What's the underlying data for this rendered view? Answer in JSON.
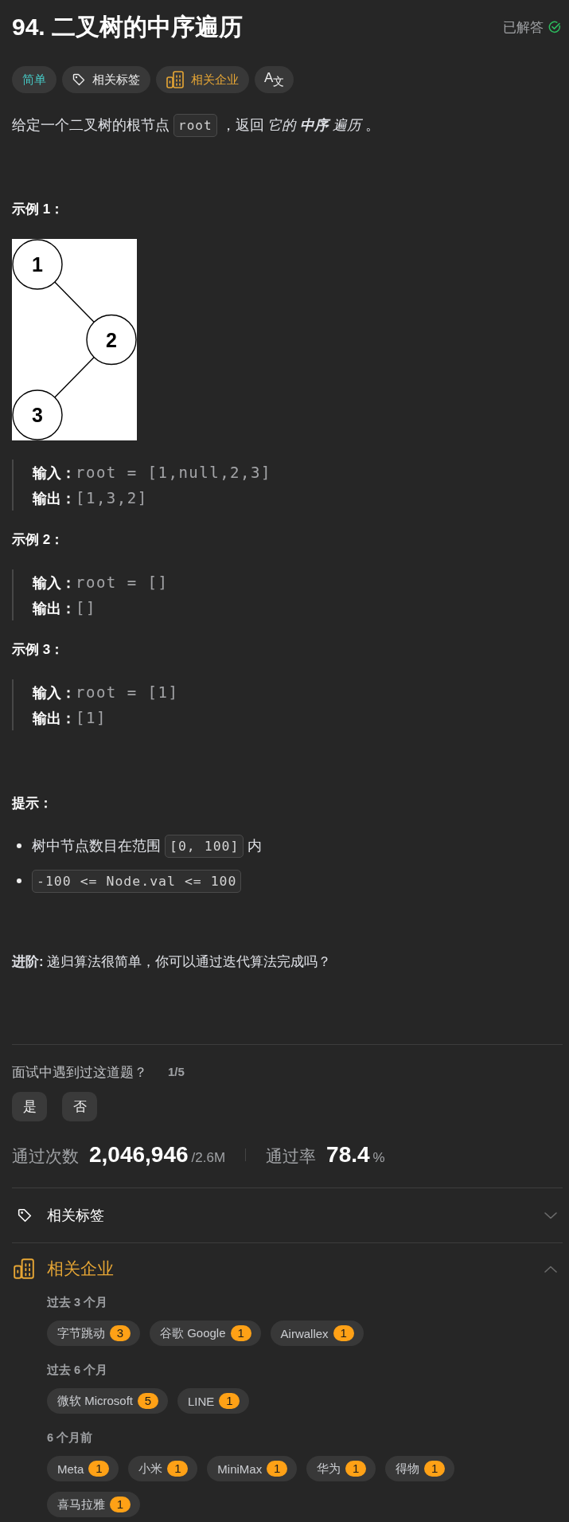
{
  "header": {
    "title": "94. 二叉树的中序遍历",
    "status": "已解答",
    "solved": true
  },
  "tags": [
    {
      "kind": "difficulty",
      "label": "简单"
    },
    {
      "kind": "topics",
      "label": "相关标签"
    },
    {
      "kind": "companies",
      "label": "相关企业"
    },
    {
      "kind": "translate",
      "label": "A$_{文}$"
    }
  ],
  "description": [
    {
      "kind": "text",
      "text": "给定一个二叉树的根节点"
    },
    {
      "kind": "code",
      "text": "root"
    },
    {
      "kind": "text",
      "text": "，返回 "
    },
    {
      "kind": "em",
      "text": "它的 **中序** 遍历"
    },
    {
      "kind": "text",
      "text": " 。"
    }
  ],
  "examples": [
    {
      "title": "示例 1：",
      "tree": {
        "label": "1",
        "children": [
          {
            "label": "2",
            "right": true,
            "children": [
              {
                "label": "3",
                "right": false
              }
            ]
          }
        ]
      },
      "lines": [
        {
          "label": "输入：",
          "value": "root = [1,null,2,3]"
        },
        {
          "label": "输出：",
          "value": "[1,3,2]"
        }
      ]
    },
    {
      "title": "示例 2：",
      "lines": [
        {
          "label": "输入：",
          "value": "root = []"
        },
        {
          "label": "输出：",
          "value": "[]"
        }
      ]
    },
    {
      "title": "示例 3：",
      "lines": [
        {
          "label": "输入：",
          "value": "root = [1]"
        },
        {
          "label": "输出：",
          "value": "[1]"
        }
      ]
    }
  ],
  "hints": {
    "title": "提示：",
    "items": [
      {
        "segments": [
          {
            "kind": "text",
            "text": "树中节点数目在范围"
          },
          {
            "kind": "code",
            "text": "[0, 100]"
          },
          {
            "kind": "text",
            "text": "内"
          }
        ]
      },
      {
        "segments": [
          {
            "kind": "code",
            "text": "-100 <= Node.val <= 100"
          }
        ]
      }
    ]
  },
  "follow_up": "**进阶:** 递归算法很简单，你可以通过迭代算法完成吗？",
  "interview": {
    "question": "面试中遇到过这道题？",
    "counter": "1/5",
    "answers": [
      "是",
      "否"
    ]
  },
  "stats": [
    {
      "label": "通过次数",
      "value": "2,046,946",
      "suffix": "/2.6M"
    },
    {
      "label": "通过率",
      "value": "78.4",
      "suffix": "%"
    }
  ],
  "sections": [
    {
      "kind": "topics",
      "title": "相关标签",
      "expanded": false
    },
    {
      "kind": "companies",
      "title": "相关企业",
      "expanded": true,
      "groups": [
        {
          "period": "过去 3 个月",
          "companies": [
            {
              "name": "字节跳动",
              "count": "3"
            },
            {
              "name": "谷歌 Google",
              "count": "1"
            },
            {
              "name": "Airwallex",
              "count": "1"
            }
          ]
        },
        {
          "period": "过去 6 个月",
          "companies": [
            {
              "name": "微软 Microsoft",
              "count": "5"
            },
            {
              "name": "LINE",
              "count": "1"
            }
          ]
        },
        {
          "period": "6 个月前",
          "companies": [
            {
              "name": "Meta",
              "count": "1"
            },
            {
              "name": "小米",
              "count": "1"
            },
            {
              "name": "MiniMax",
              "count": "1"
            },
            {
              "name": "华为",
              "count": "1"
            },
            {
              "name": "得物",
              "count": "1"
            },
            {
              "name": "喜马拉雅",
              "count": "1"
            }
          ]
        }
      ]
    }
  ]
}
